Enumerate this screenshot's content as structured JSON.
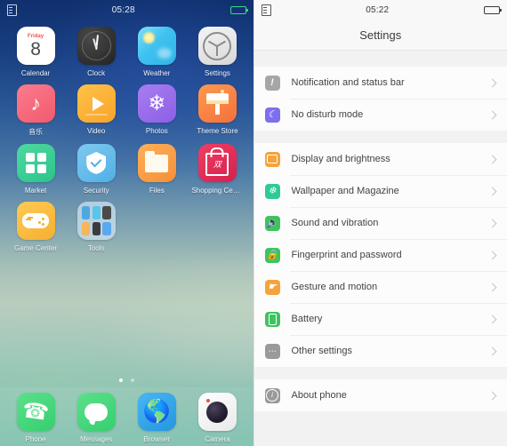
{
  "home": {
    "status_bar": {
      "sim_icon": "sim-card-icon",
      "time": "05:28",
      "battery_icon": "battery-charging-icon"
    },
    "rows": [
      [
        {
          "label": "Calendar",
          "icon": "calendar-icon",
          "day_name": "Friday",
          "day_number": "8"
        },
        {
          "label": "Clock",
          "icon": "clock-icon"
        },
        {
          "label": "Weather",
          "icon": "weather-icon"
        },
        {
          "label": "Settings",
          "icon": "settings-gear-icon"
        }
      ],
      [
        {
          "label": "音乐",
          "icon": "music-note-icon"
        },
        {
          "label": "Video",
          "icon": "video-play-icon"
        },
        {
          "label": "Photos",
          "icon": "photos-flower-icon"
        },
        {
          "label": "Theme Store",
          "icon": "theme-store-icon"
        }
      ],
      [
        {
          "label": "Market",
          "icon": "market-grid-icon"
        },
        {
          "label": "Security",
          "icon": "security-shield-icon"
        },
        {
          "label": "Files",
          "icon": "files-folder-icon"
        },
        {
          "label": "Shopping Cen···",
          "icon": "shopping-bag-icon"
        }
      ],
      [
        {
          "label": "Game Center",
          "icon": "gamepad-icon"
        },
        {
          "label": "Tools",
          "icon": "tools-folder-icon"
        }
      ]
    ],
    "page_dots": {
      "count": 2,
      "active_index": 0
    },
    "dock": [
      {
        "label": "Phone",
        "icon": "phone-handset-icon"
      },
      {
        "label": "Messages",
        "icon": "message-bubble-icon"
      },
      {
        "label": "Browser",
        "icon": "browser-globe-icon"
      },
      {
        "label": "Camera",
        "icon": "camera-lens-icon"
      }
    ]
  },
  "settings": {
    "status_bar": {
      "sim_icon": "sim-card-icon",
      "time": "05:22",
      "battery_icon": "battery-icon"
    },
    "nav_title": "Settings",
    "groups": [
      {
        "rows": [
          {
            "label": "Notification and status bar",
            "icon": "notification-icon",
            "color": "#a6a6a6"
          },
          {
            "label": "No disturb mode",
            "icon": "moon-icon",
            "color": "#7c6ff0"
          }
        ]
      },
      {
        "rows": [
          {
            "label": "Display and brightness",
            "icon": "display-icon",
            "color": "#f5a33c"
          },
          {
            "label": "Wallpaper and Magazine",
            "icon": "wallpaper-icon",
            "color": "#2ecb92"
          },
          {
            "label": "Sound and vibration",
            "icon": "sound-icon",
            "color": "#3ec45f"
          },
          {
            "label": "Fingerprint and password",
            "icon": "lock-icon",
            "color": "#3ec45f"
          },
          {
            "label": "Gesture and motion",
            "icon": "gesture-icon",
            "color": "#f5a33c"
          },
          {
            "label": "Battery",
            "icon": "battery-setting-icon",
            "color": "#3ec45f"
          },
          {
            "label": "Other settings",
            "icon": "more-dots-icon",
            "color": "#9a9a9a"
          }
        ]
      },
      {
        "rows": [
          {
            "label": "About phone",
            "icon": "info-icon",
            "color": "#9a9a9a"
          }
        ]
      }
    ]
  }
}
